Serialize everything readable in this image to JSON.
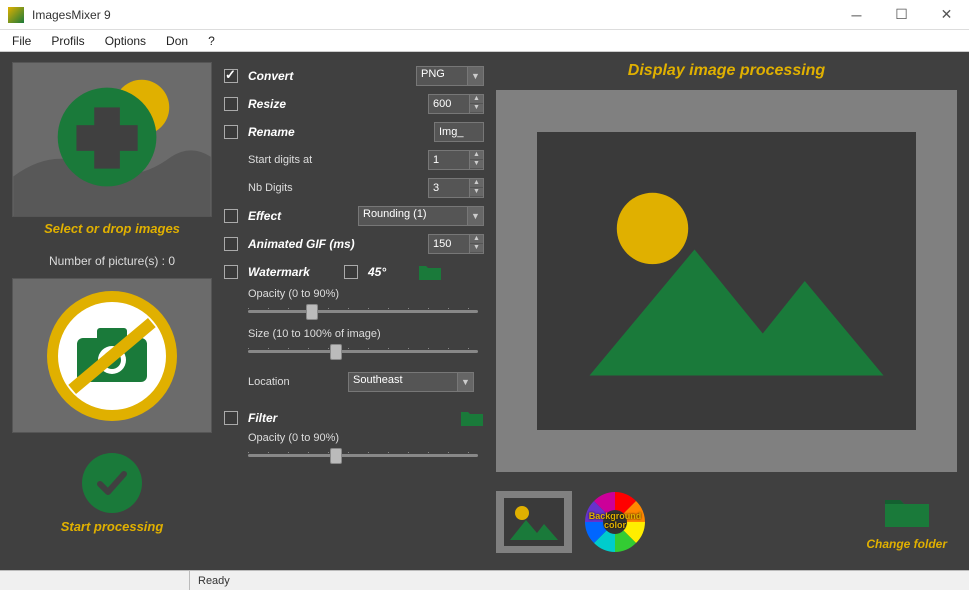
{
  "window": {
    "title": "ImagesMixer 9"
  },
  "menu": {
    "file": "File",
    "profiles": "Profils",
    "options": "Options",
    "don": "Don",
    "help": "?"
  },
  "left": {
    "drop_label": "Select or drop images",
    "count_label": "Number of picture(s) : 0",
    "start_label": "Start processing"
  },
  "opts": {
    "convert": {
      "label": "Convert",
      "value": "PNG",
      "checked": true
    },
    "resize": {
      "label": "Resize",
      "value": "600",
      "checked": false
    },
    "rename": {
      "label": "Rename",
      "value": "Img_",
      "checked": false,
      "start_label": "Start digits at",
      "start_value": "1",
      "nb_label": "Nb Digits",
      "nb_value": "3"
    },
    "effect": {
      "label": "Effect",
      "value": "Rounding (1)",
      "checked": false
    },
    "agif": {
      "label": "Animated GIF (ms)",
      "value": "150",
      "checked": false
    },
    "watermark": {
      "label": "Watermark",
      "angle_label": "45°",
      "checked": false,
      "angle_checked": false,
      "opacity_label": "Opacity (0 to 90%)",
      "size_label": "Size (10 to 100% of image)",
      "location_label": "Location",
      "location_value": "Southeast"
    },
    "filter": {
      "label": "Filter",
      "checked": false,
      "opacity_label": "Opacity (0 to 90%)"
    }
  },
  "preview": {
    "title": "Display image processing"
  },
  "bottom": {
    "bgcolor_label": "Background color",
    "change_folder": "Change folder"
  },
  "status": {
    "ready": "Ready"
  }
}
